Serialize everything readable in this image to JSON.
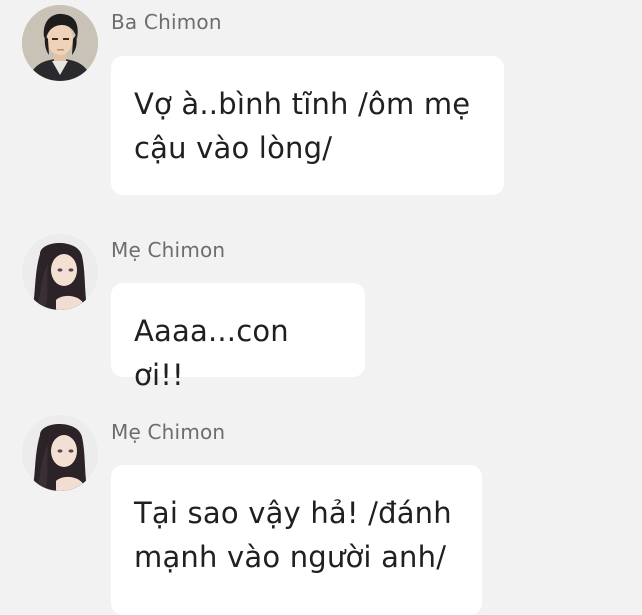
{
  "messages": [
    {
      "sender": "Ba Chimon",
      "avatar_icon": "man-portrait-avatar",
      "lines": [
        "Vợ à..bình tĩnh /ôm mẹ",
        "cậu vào lòng/"
      ]
    },
    {
      "sender": "Mẹ Chimon",
      "avatar_icon": "woman-portrait-avatar",
      "lines": [
        "Aaaa...con ơi!!"
      ]
    },
    {
      "sender": "Mẹ Chimon",
      "avatar_icon": "woman-portrait-avatar",
      "lines": [
        "Tại sao vậy hả! /đánh",
        "mạnh vào người anh/"
      ]
    }
  ],
  "colors": {
    "background": "#f2f2f2",
    "bubble": "#ffffff",
    "sender_text": "#6d6d6d",
    "message_text": "#202020"
  }
}
